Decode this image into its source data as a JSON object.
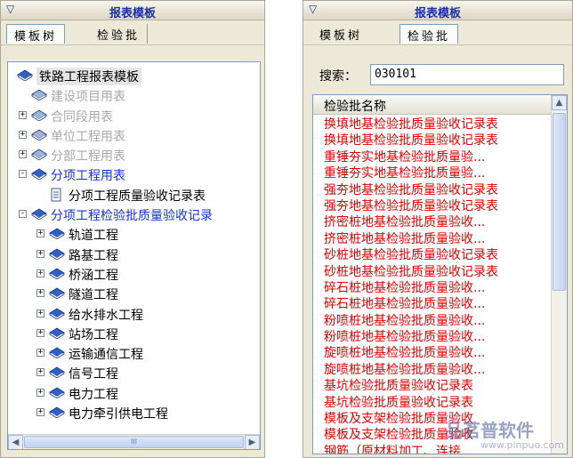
{
  "left_panel": {
    "title": "报表模板",
    "tabs": [
      {
        "label": "模板树",
        "active": true
      },
      {
        "label": "检验批",
        "active": false
      }
    ],
    "tree": [
      {
        "label": "铁路工程报表模板",
        "level": 0,
        "expander": "",
        "style": "root",
        "icon": "book-icon"
      },
      {
        "label": "建设项目用表",
        "level": 1,
        "expander": "",
        "style": "grey",
        "icon": "book-icon"
      },
      {
        "label": "合同段用表",
        "level": 1,
        "expander": "+",
        "style": "grey",
        "icon": "book-icon"
      },
      {
        "label": "单位工程用表",
        "level": 1,
        "expander": "+",
        "style": "grey",
        "icon": "book-icon"
      },
      {
        "label": "分部工程用表",
        "level": 1,
        "expander": "+",
        "style": "grey",
        "icon": "book-icon"
      },
      {
        "label": "分项工程用表",
        "level": 1,
        "expander": "-",
        "style": "blue",
        "icon": "book-icon"
      },
      {
        "label": "分项工程质量验收记录表",
        "level": 2,
        "expander": "",
        "style": "black",
        "icon": "document-icon"
      },
      {
        "label": "分项工程检验批质量验收记录",
        "level": 1,
        "expander": "-",
        "style": "blue",
        "icon": "book-icon"
      },
      {
        "label": "轨道工程",
        "level": 2,
        "expander": "+",
        "style": "black",
        "icon": "book-icon"
      },
      {
        "label": "路基工程",
        "level": 2,
        "expander": "+",
        "style": "black",
        "icon": "book-icon"
      },
      {
        "label": "桥涵工程",
        "level": 2,
        "expander": "+",
        "style": "black",
        "icon": "book-icon"
      },
      {
        "label": "隧道工程",
        "level": 2,
        "expander": "+",
        "style": "black",
        "icon": "book-icon"
      },
      {
        "label": "给水排水工程",
        "level": 2,
        "expander": "+",
        "style": "black",
        "icon": "book-icon"
      },
      {
        "label": "站场工程",
        "level": 2,
        "expander": "+",
        "style": "black",
        "icon": "book-icon"
      },
      {
        "label": "运输通信工程",
        "level": 2,
        "expander": "+",
        "style": "black",
        "icon": "book-icon"
      },
      {
        "label": "信号工程",
        "level": 2,
        "expander": "+",
        "style": "black",
        "icon": "book-icon"
      },
      {
        "label": "电力工程",
        "level": 2,
        "expander": "+",
        "style": "black",
        "icon": "book-icon"
      },
      {
        "label": "电力牵引供电工程",
        "level": 2,
        "expander": "+",
        "style": "black",
        "icon": "book-icon"
      }
    ],
    "scroll_grip": "III"
  },
  "right_panel": {
    "title": "报表模板",
    "tabs": [
      {
        "label": "模板树",
        "active": false
      },
      {
        "label": "检验批",
        "active": true
      }
    ],
    "search_label": "搜索：",
    "search_value": "030101",
    "list_header": "检验批名称",
    "rows": [
      "换填地基检验批质量验收记录表",
      "换填地基检验批质量验收记录表",
      "重锤夯实地基检验批质量验...",
      "重锤夯实地基检验批质量验...",
      "强夯地基检验批质量验收记录表",
      "强夯地基检验批质量验收记录表",
      "挤密桩地基检验批质量验收...",
      "挤密桩地基检验批质量验收...",
      "砂桩地基检验批质量验收记录表",
      "砂桩地基检验批质量验收记录表",
      "碎石桩地基检验批质量验收...",
      "碎石桩地基检验批质量验收...",
      "粉喷桩地基检验批质量验收...",
      "粉喷桩地基检验批质量验收...",
      "旋喷桩地基检验批质量验收...",
      "旋喷桩地基检验批质量验收...",
      "基坑检验批质量验收记录表",
      "基坑检验批质量验收记录表",
      "模板及支架检验批质量验收",
      "模板及支架检验批质量验收",
      "钢筋（原材料加工、连接..."
    ]
  },
  "watermark": {
    "text": "品茗普软件",
    "url": "www.pinpuo.com"
  },
  "colors": {
    "tree_blue": "#1632d9",
    "list_red": "#e00000",
    "tree_grey": "#a8a8a8"
  }
}
